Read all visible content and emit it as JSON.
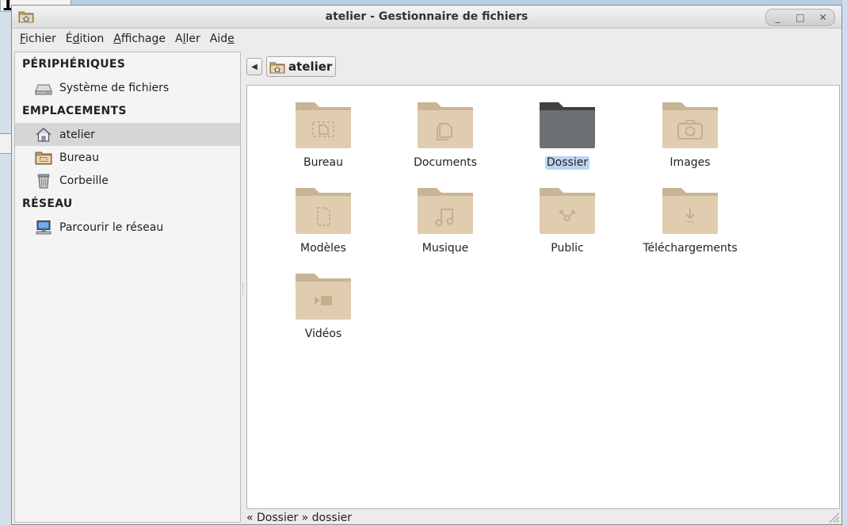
{
  "background": {
    "glyph": "1"
  },
  "window": {
    "title": "atelier - Gestionnaire de fichiers",
    "controls": [
      "_",
      "□",
      "✕"
    ]
  },
  "menubar": {
    "items": [
      {
        "pre": "",
        "key": "F",
        "post": "ichier"
      },
      {
        "pre": "É",
        "key": "d",
        "post": "ition"
      },
      {
        "pre": "",
        "key": "A",
        "post": "ffichage"
      },
      {
        "pre": "A",
        "key": "l",
        "post": "ler"
      },
      {
        "pre": "Aid",
        "key": "e",
        "post": ""
      }
    ]
  },
  "sidebar": {
    "sections": [
      {
        "title": "PÉRIPHÉRIQUES",
        "items": [
          {
            "label": "Système de fichiers",
            "icon": "drive-icon"
          }
        ]
      },
      {
        "title": "EMPLACEMENTS",
        "items": [
          {
            "label": "atelier",
            "icon": "home-folder-icon",
            "selected": true
          },
          {
            "label": "Bureau",
            "icon": "desktop-folder-icon"
          },
          {
            "label": "Corbeille",
            "icon": "trash-icon"
          }
        ]
      },
      {
        "title": "RÉSEAU",
        "items": [
          {
            "label": "Parcourir le réseau",
            "icon": "network-icon"
          }
        ]
      }
    ]
  },
  "pathbar": {
    "back_icon": "◀",
    "crumb": "atelier"
  },
  "files": [
    {
      "label": "Bureau",
      "icon": "desktop-folder-icon"
    },
    {
      "label": "Documents",
      "icon": "documents-folder-icon"
    },
    {
      "label": "Dossier",
      "icon": "folder-icon",
      "selected": true
    },
    {
      "label": "Images",
      "icon": "pictures-folder-icon"
    },
    {
      "label": "Modèles",
      "icon": "templates-folder-icon"
    },
    {
      "label": "Musique",
      "icon": "music-folder-icon"
    },
    {
      "label": "Public",
      "icon": "public-folder-icon"
    },
    {
      "label": "Téléchargements",
      "icon": "downloads-folder-icon"
    },
    {
      "label": "Vidéos",
      "icon": "videos-folder-icon"
    }
  ],
  "status": {
    "text": "« Dossier » dossier"
  },
  "colors": {
    "folder": "#e0cdb0",
    "folder_tab": "#c8b496",
    "folder_selected": "#6d7072",
    "selection": "#bcd4f2"
  }
}
